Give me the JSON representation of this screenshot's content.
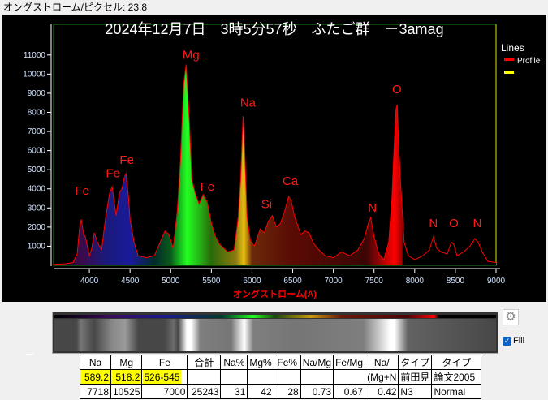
{
  "header": {
    "label": "オングストローム/ピクセル: 23.8"
  },
  "chart_data": {
    "type": "area",
    "title": "2024年12月7日　3時5分57秒　ふたご群　－3amag",
    "xlabel": "オングストローム(A)",
    "ylabel": "",
    "xlim": [
      3560,
      9000
    ],
    "ylim": [
      0,
      11500
    ],
    "xticks": [
      4000,
      4500,
      5000,
      5500,
      6000,
      6500,
      7000,
      7500,
      8000,
      8500,
      9000
    ],
    "yticks": [
      1000,
      2000,
      3000,
      4000,
      5000,
      6000,
      7000,
      8000,
      9000,
      10000,
      11000
    ],
    "legend": {
      "title": "Lines",
      "placement": "right",
      "entries": [
        {
          "name": "Profile",
          "color": "#ff0000"
        },
        {
          "name": "",
          "color": "#ffff00"
        }
      ]
    },
    "series": [
      {
        "name": "Profile",
        "color": "#ff0000",
        "x": [
          3560,
          3700,
          3800,
          3850,
          3880,
          3900,
          3930,
          3950,
          4000,
          4030,
          4060,
          4100,
          4150,
          4200,
          4250,
          4280,
          4300,
          4330,
          4370,
          4400,
          4430,
          4450,
          4480,
          4500,
          4550,
          4600,
          4700,
          4800,
          4870,
          4930,
          4980,
          5030,
          5080,
          5120,
          5160,
          5190,
          5210,
          5230,
          5260,
          5300,
          5350,
          5400,
          5450,
          5500,
          5550,
          5600,
          5700,
          5780,
          5830,
          5860,
          5890,
          5910,
          5940,
          5980,
          6030,
          6100,
          6150,
          6200,
          6250,
          6300,
          6350,
          6400,
          6450,
          6480,
          6520,
          6600,
          6650,
          6700,
          6750,
          6800,
          6900,
          7000,
          7100,
          7200,
          7300,
          7380,
          7430,
          7460,
          7500,
          7560,
          7620,
          7680,
          7720,
          7750,
          7770,
          7785,
          7800,
          7830,
          7870,
          7920,
          8000,
          8100,
          8180,
          8230,
          8270,
          8320,
          8400,
          8450,
          8480,
          8520,
          8600,
          8680,
          8740,
          8780,
          8830,
          8900,
          9000
        ],
        "y": [
          50,
          80,
          150,
          600,
          2000,
          2400,
          1600,
          1500,
          500,
          900,
          1700,
          1200,
          800,
          2500,
          3800,
          4100,
          3500,
          2600,
          3800,
          4000,
          4600,
          4800,
          3600,
          2400,
          1200,
          500,
          400,
          500,
          1200,
          1800,
          1600,
          900,
          2800,
          5500,
          9500,
          10500,
          9000,
          7500,
          4500,
          3800,
          3200,
          3700,
          3300,
          2200,
          1500,
          1100,
          700,
          800,
          2500,
          4500,
          7800,
          6000,
          2500,
          1300,
          1000,
          1900,
          1700,
          2300,
          2600,
          2000,
          2200,
          2800,
          3600,
          3400,
          2600,
          1600,
          1800,
          1700,
          1200,
          900,
          500,
          400,
          700,
          500,
          800,
          1400,
          2200,
          2500,
          1500,
          600,
          300,
          1200,
          3500,
          6500,
          8200,
          8400,
          6500,
          4000,
          1200,
          500,
          300,
          500,
          800,
          1500,
          900,
          700,
          600,
          1200,
          1100,
          500,
          700,
          1000,
          1400,
          1200,
          700,
          200,
          150
        ]
      }
    ],
    "annotations": [
      {
        "text": "Fe",
        "x": 3910,
        "y": 3700
      },
      {
        "text": "Fe",
        "x": 4290,
        "y": 4600
      },
      {
        "text": "Fe",
        "x": 4460,
        "y": 5300
      },
      {
        "text": "Mg",
        "x": 5250,
        "y": 10800
      },
      {
        "text": "Fe",
        "x": 5450,
        "y": 3900
      },
      {
        "text": "Na",
        "x": 5950,
        "y": 8300
      },
      {
        "text": "Si",
        "x": 6180,
        "y": 3000
      },
      {
        "text": "Ca",
        "x": 6470,
        "y": 4200
      },
      {
        "text": "N",
        "x": 7480,
        "y": 2800
      },
      {
        "text": "O",
        "x": 7780,
        "y": 9000
      },
      {
        "text": "N",
        "x": 8230,
        "y": 2000
      },
      {
        "text": "O",
        "x": 8480,
        "y": 2000
      },
      {
        "text": "N",
        "x": 8770,
        "y": 2000
      }
    ]
  },
  "controls": {
    "fill_label": "Fill",
    "fill_checked": true,
    "settings_icon": "gear-icon"
  },
  "table": {
    "headers": [
      "Na",
      "Mg",
      "Fe",
      "合計",
      "Na%",
      "Mg%",
      "Fe%",
      "Na/Mg",
      "Fe/Mg",
      "Na/",
      "タイプ",
      "タイプ"
    ],
    "rows": [
      [
        "589.2",
        "518.2",
        "526-545",
        "",
        "",
        "",
        "",
        "",
        "",
        "(Mg+N",
        "前田見",
        "論文2005"
      ],
      [
        "7718",
        "10525",
        "7000",
        "25243",
        "31",
        "42",
        "28",
        "0.73",
        "0.67",
        "0.42",
        "N3",
        "Normal"
      ]
    ]
  }
}
